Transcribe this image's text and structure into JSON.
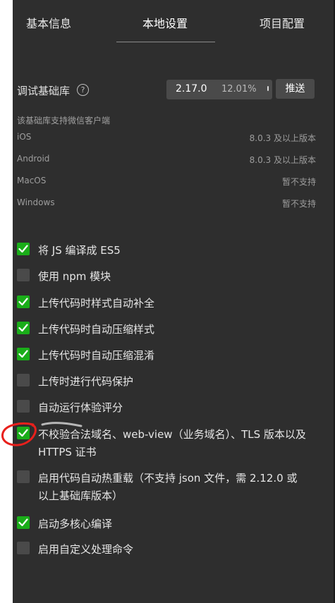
{
  "tabs": [
    {
      "label": "基本信息"
    },
    {
      "label": "本地设置"
    },
    {
      "label": "项目配置"
    }
  ],
  "sdk": {
    "label": "调试基础库",
    "help_icon": "question-circle-icon",
    "version": "2.17.0",
    "percent": "12.01%",
    "push_label": "推送"
  },
  "support": {
    "note": "该基础库支持微信客户端",
    "platforms": [
      {
        "name": "iOS",
        "value": "8.0.3 及以上版本"
      },
      {
        "name": "Android",
        "value": "8.0.3 及以上版本"
      },
      {
        "name": "MacOS",
        "value": "暂不支持"
      },
      {
        "name": "Windows",
        "value": "暂不支持"
      }
    ]
  },
  "options": [
    {
      "label": "将 JS 编译成 ES5",
      "checked": true
    },
    {
      "label": "使用 npm 模块",
      "checked": false
    },
    {
      "label": "上传代码时样式自动补全",
      "checked": true
    },
    {
      "label": "上传代码时自动压缩样式",
      "checked": true
    },
    {
      "label": "上传代码时自动压缩混淆",
      "checked": true
    },
    {
      "label": "上传时进行代码保护",
      "checked": false
    },
    {
      "label": "自动运行体验评分",
      "checked": false
    },
    {
      "label": "不校验合法域名、web-view（业务域名）、TLS 版本以及 HTTPS 证书",
      "checked": true
    },
    {
      "label": "启用代码自动热重载（不支持 json 文件，需 2.12.0 或以上基础库版本）",
      "checked": false
    },
    {
      "label": "启动多核心编译",
      "checked": true
    },
    {
      "label": "启用自定义处理命令",
      "checked": false
    }
  ],
  "colors": {
    "panel_bg": "#2e2e2e",
    "checked": "#1aad19",
    "unchecked": "#4a4a4a",
    "annotation": "#e8201c"
  }
}
